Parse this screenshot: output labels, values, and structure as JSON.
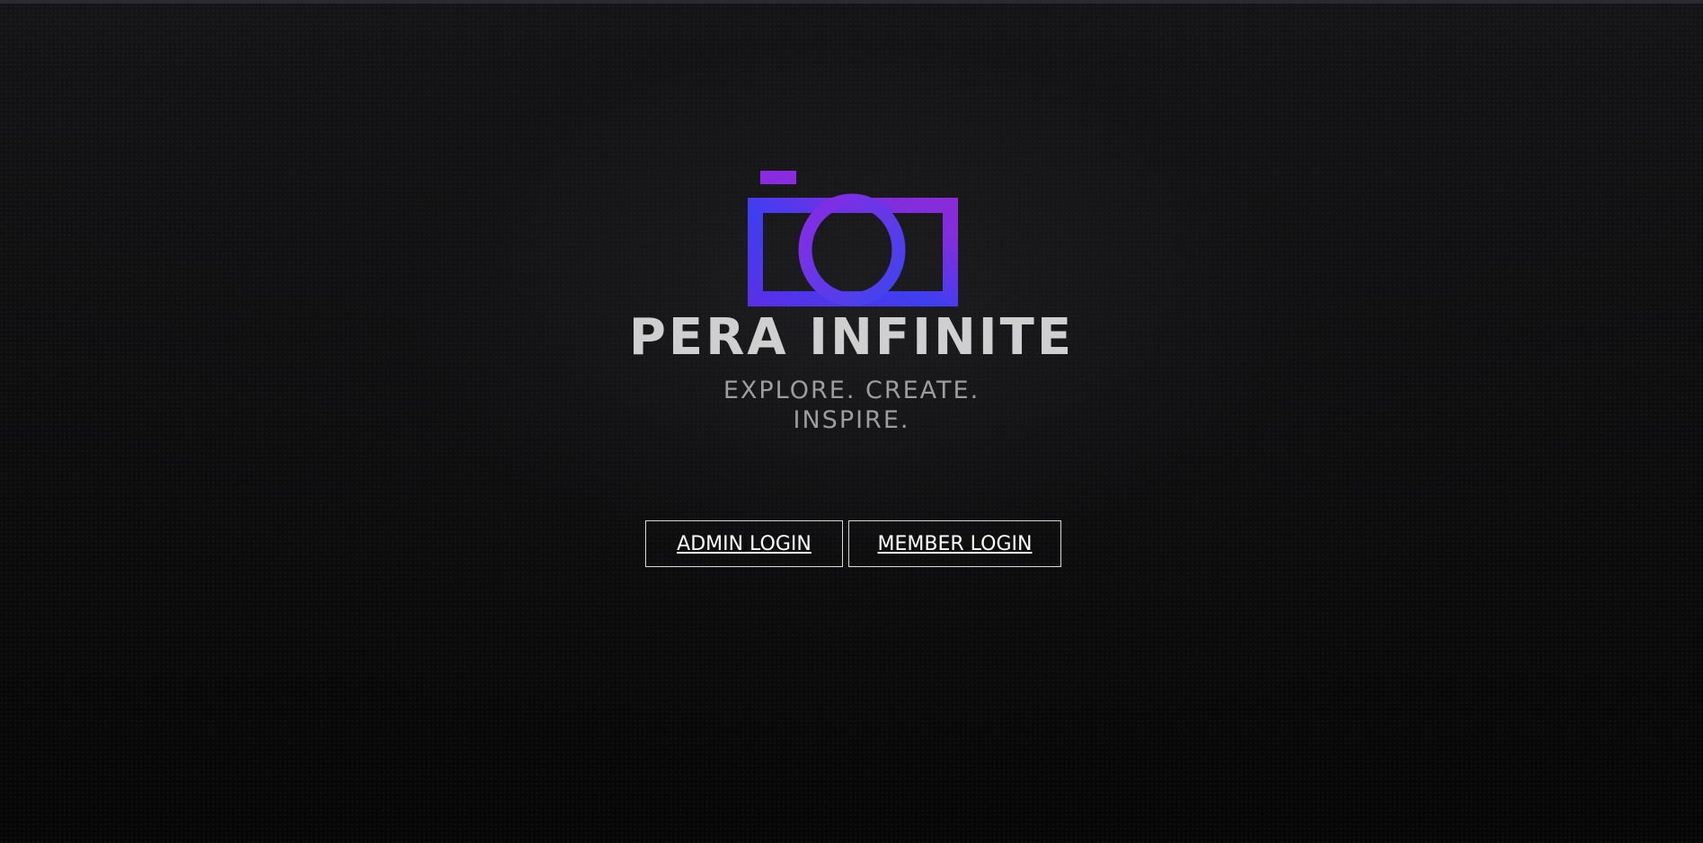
{
  "brand": {
    "name": "PERA INFINITE",
    "tagline": "EXPLORE. CREATE. INSPIRE.",
    "logo_icon": "camera-icon",
    "colors": {
      "logo_purple": "#8a2be2",
      "logo_blue": "#4b3cf0",
      "name_text": "#cfcfcf",
      "tagline_text": "#9d9d9d"
    }
  },
  "actions": {
    "admin_login_label": "ADMIN LOGIN",
    "member_login_label": "MEMBER LOGIN"
  },
  "theme": {
    "background": "#0b0b0c",
    "button_border": "#d8d8d8",
    "button_text": "#ffffff"
  }
}
